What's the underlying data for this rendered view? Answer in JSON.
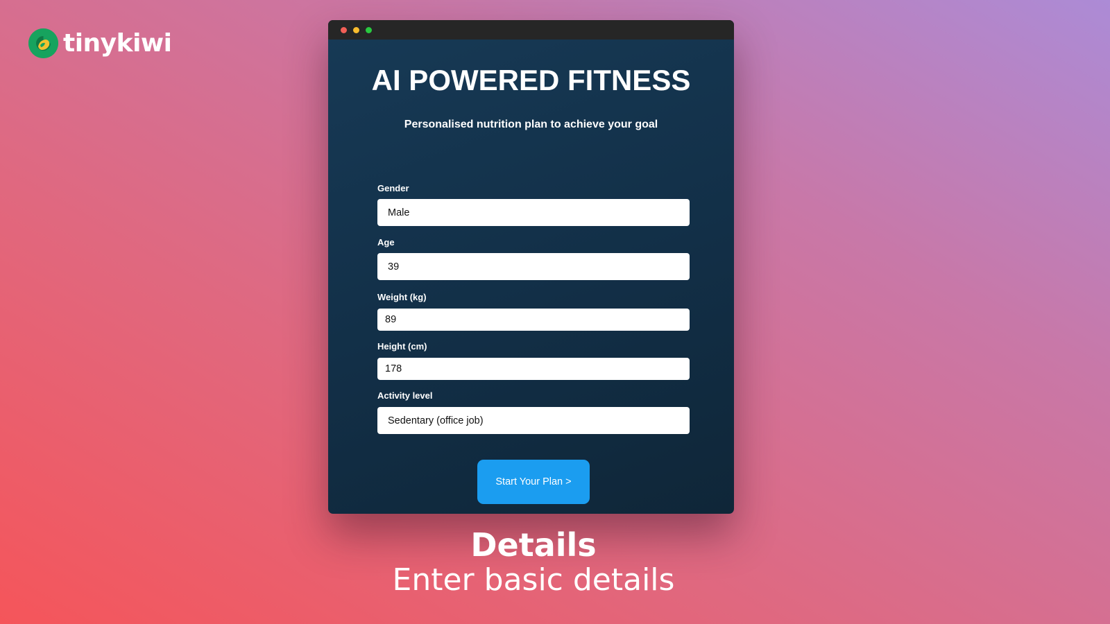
{
  "brand": {
    "name": "tinykiwi",
    "logo_icon": "kiwi-logo-icon",
    "logo_color": "#17a35e"
  },
  "window": {
    "controls": [
      "close-dot-icon",
      "minimize-dot-icon",
      "maximize-dot-icon"
    ],
    "title": "AI POWERED FITNESS",
    "subtitle": "Personalised nutrition plan to achieve your goal"
  },
  "form": {
    "gender": {
      "label": "Gender",
      "value": "Male"
    },
    "age": {
      "label": "Age",
      "value": "39"
    },
    "weight": {
      "label": "Weight (kg)",
      "value": "89"
    },
    "height": {
      "label": "Height (cm)",
      "value": "178"
    },
    "activity": {
      "label": "Activity level",
      "value": "Sedentary (office job)"
    }
  },
  "cta": {
    "label": "Start Your Plan >",
    "color": "#1b9df0"
  },
  "caption": {
    "title": "Details",
    "subtitle": "Enter basic details"
  }
}
